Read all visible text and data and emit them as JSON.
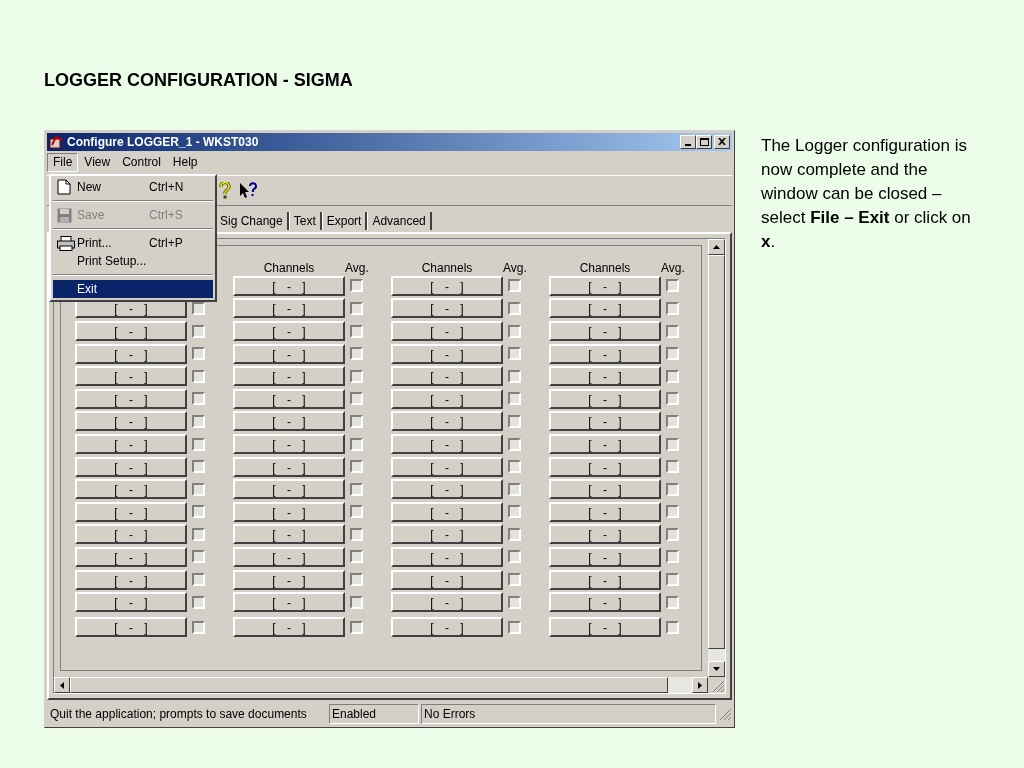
{
  "slide": {
    "title": "LOGGER CONFIGURATION - SIGMA",
    "note": "The Logger configuration is now complete and the window can be closed – select **File – Exit** or click on **x**."
  },
  "window": {
    "title": "Configure LOGGER_1 - WKST030"
  },
  "menu_bar": [
    {
      "label": "File",
      "selected": true
    },
    {
      "label": "View",
      "selected": false
    },
    {
      "label": "Control",
      "selected": false
    },
    {
      "label": "Help",
      "selected": false
    }
  ],
  "file_menu": [
    {
      "kind": "item",
      "label": "New",
      "shortcut": "Ctrl+N",
      "disabled": false,
      "selected": false
    },
    {
      "kind": "separator"
    },
    {
      "kind": "item",
      "label": "Save",
      "shortcut": "Ctrl+S",
      "disabled": true,
      "selected": false
    },
    {
      "kind": "separator"
    },
    {
      "kind": "item",
      "label": "Print...",
      "shortcut": "Ctrl+P",
      "disabled": false,
      "selected": false
    },
    {
      "kind": "item",
      "label": "Print Setup...",
      "disabled": false,
      "selected": false
    },
    {
      "kind": "separator"
    },
    {
      "kind": "item",
      "label": "Exit",
      "disabled": false,
      "selected": true
    }
  ],
  "tabs": [
    {
      "label": "Sig Change",
      "selected": false
    },
    {
      "label": "Text",
      "selected": false
    },
    {
      "label": "Export",
      "selected": false
    },
    {
      "label": "Advanced",
      "selected": false
    }
  ],
  "grid": {
    "columns": [
      {
        "rows": [
          {
            "label": "[ - ]",
            "checked": false
          },
          {
            "label": "[ - ]",
            "checked": false
          },
          {
            "label": "[ - ]",
            "checked": false
          },
          {
            "label": "[ - ]",
            "checked": false
          },
          {
            "label": "[ - ]",
            "checked": false
          },
          {
            "label": "[ - ]",
            "checked": false
          },
          {
            "label": "[ - ]",
            "checked": false
          },
          {
            "label": "[ - ]",
            "checked": false
          },
          {
            "label": "[ - ]",
            "checked": false
          },
          {
            "label": "[ - ]",
            "checked": false
          },
          {
            "label": "[ - ]",
            "checked": false
          },
          {
            "label": "[ - ]",
            "checked": false
          },
          {
            "label": "[ - ]",
            "checked": false
          },
          {
            "label": "[ - ]",
            "checked": false
          },
          {
            "label": "[ - ]",
            "checked": false
          }
        ]
      },
      {
        "channels_header": "Channels",
        "avg_header": "Avg.",
        "rows": [
          {
            "label": "[ - ]",
            "checked": false
          },
          {
            "label": "[ - ]",
            "checked": false
          },
          {
            "label": "[ - ]",
            "checked": false
          },
          {
            "label": "[ - ]",
            "checked": false
          },
          {
            "label": "[ - ]",
            "checked": false
          },
          {
            "label": "[ - ]",
            "checked": false
          },
          {
            "label": "[ - ]",
            "checked": false
          },
          {
            "label": "[ - ]",
            "checked": false
          },
          {
            "label": "[ - ]",
            "checked": false
          },
          {
            "label": "[ - ]",
            "checked": false
          },
          {
            "label": "[ - ]",
            "checked": false
          },
          {
            "label": "[ - ]",
            "checked": false
          },
          {
            "label": "[ - ]",
            "checked": false
          },
          {
            "label": "[ - ]",
            "checked": false
          },
          {
            "label": "[ - ]",
            "checked": false
          },
          {
            "label": "[ - ]",
            "checked": false
          }
        ]
      },
      {
        "channels_header": "Channels",
        "avg_header": "Avg.",
        "rows": [
          {
            "label": "[ - ]",
            "checked": false
          },
          {
            "label": "[ - ]",
            "checked": false
          },
          {
            "label": "[ - ]",
            "checked": false
          },
          {
            "label": "[ - ]",
            "checked": false
          },
          {
            "label": "[ - ]",
            "checked": false
          },
          {
            "label": "[ - ]",
            "checked": false
          },
          {
            "label": "[ - ]",
            "checked": false
          },
          {
            "label": "[ - ]",
            "checked": false
          },
          {
            "label": "[ - ]",
            "checked": false
          },
          {
            "label": "[ - ]",
            "checked": false
          },
          {
            "label": "[ - ]",
            "checked": false
          },
          {
            "label": "[ - ]",
            "checked": false
          },
          {
            "label": "[ - ]",
            "checked": false
          },
          {
            "label": "[ - ]",
            "checked": false
          },
          {
            "label": "[ - ]",
            "checked": false
          },
          {
            "label": "[ - ]",
            "checked": false
          }
        ]
      },
      {
        "channels_header": "Channels",
        "avg_header": "Avg.",
        "rows": [
          {
            "label": "[ - ]",
            "checked": false
          },
          {
            "label": "[ - ]",
            "checked": false
          },
          {
            "label": "[ - ]",
            "checked": false
          },
          {
            "label": "[ - ]",
            "checked": false
          },
          {
            "label": "[ - ]",
            "checked": false
          },
          {
            "label": "[ - ]",
            "checked": false
          },
          {
            "label": "[ - ]",
            "checked": false
          },
          {
            "label": "[ - ]",
            "checked": false
          },
          {
            "label": "[ - ]",
            "checked": false
          },
          {
            "label": "[ - ]",
            "checked": false
          },
          {
            "label": "[ - ]",
            "checked": false
          },
          {
            "label": "[ - ]",
            "checked": false
          },
          {
            "label": "[ - ]",
            "checked": false
          },
          {
            "label": "[ - ]",
            "checked": false
          },
          {
            "label": "[ - ]",
            "checked": false
          },
          {
            "label": "[ - ]",
            "checked": false
          }
        ]
      }
    ]
  },
  "status_bar": [
    "Quit the application; prompts to save documents",
    "Enabled",
    "No Errors"
  ]
}
